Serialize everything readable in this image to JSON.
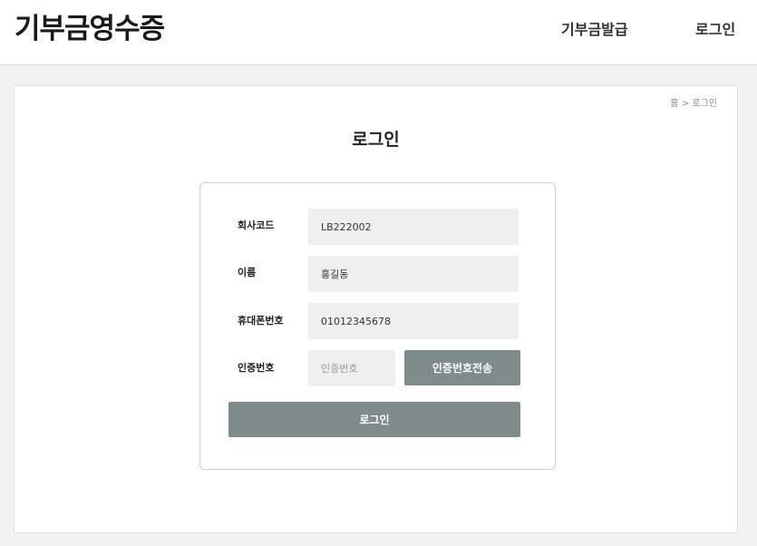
{
  "header": {
    "logo": "기부금영수증",
    "nav": {
      "issue": "기부금발급",
      "login": "로그인"
    }
  },
  "breadcrumb": {
    "home": "홈",
    "separator": ">",
    "current": "로그인"
  },
  "page_title": "로그인",
  "form": {
    "company_code": {
      "label": "회사코드",
      "value": "LB222002"
    },
    "name": {
      "label": "이름",
      "value": "홍길동"
    },
    "phone": {
      "label": "휴대폰번호",
      "value": "01012345678"
    },
    "auth_code": {
      "label": "인증번호",
      "placeholder": "인증번호"
    },
    "send_button": "인증번호전송",
    "login_button": "로그인"
  },
  "colors": {
    "button_bg": "#7f8a8a",
    "field_bg": "#eef0f0"
  }
}
